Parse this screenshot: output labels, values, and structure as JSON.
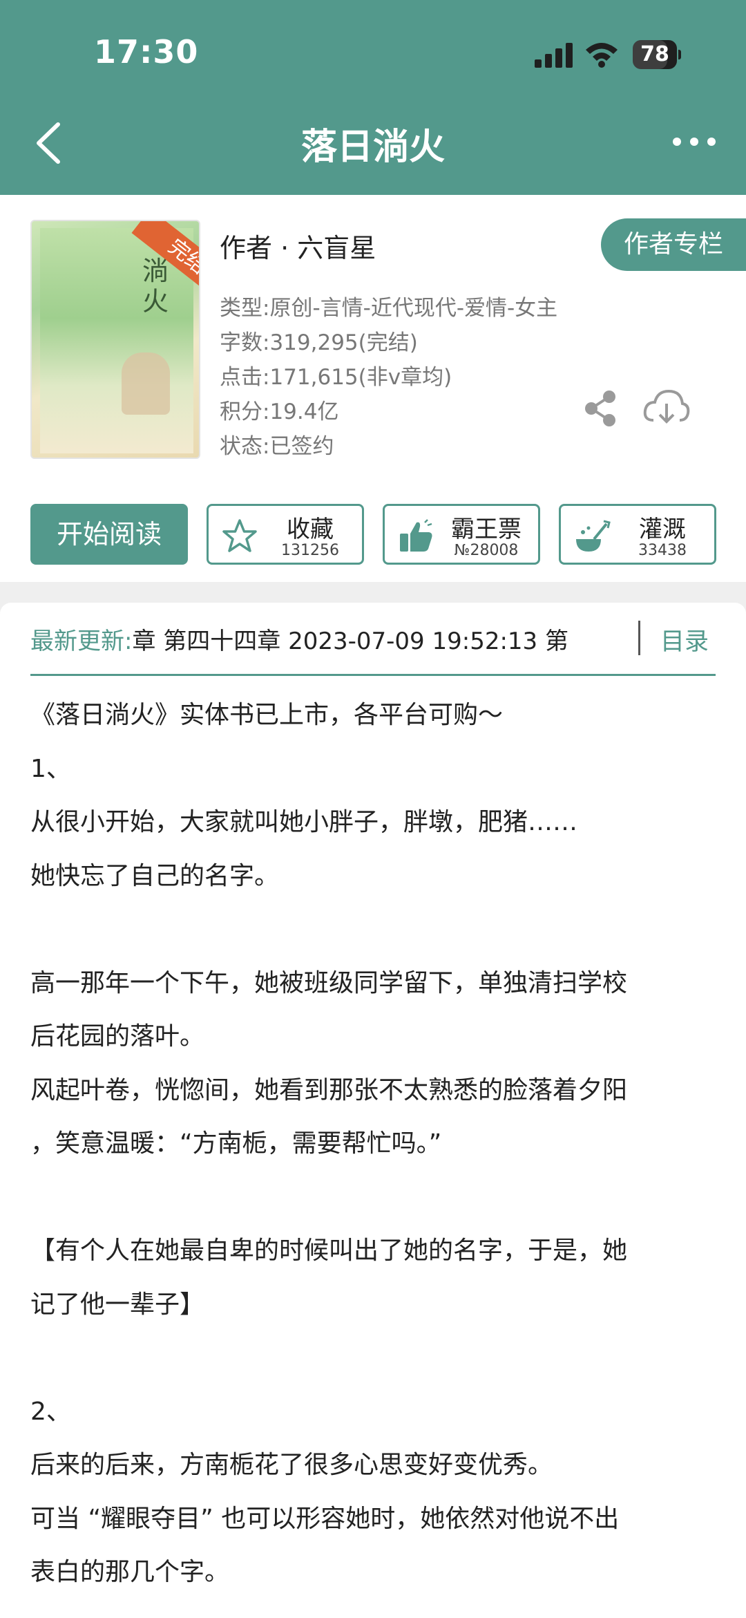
{
  "status_bar": {
    "time": "17:30",
    "battery": "78",
    "battery_level": 0.78
  },
  "nav": {
    "title": "落日淌火"
  },
  "book": {
    "cover_title": "淌火",
    "badge": "完结",
    "author": "作者 · 六盲星",
    "author_column_label": "作者专栏",
    "meta": [
      "类型:原创-言情-近代现代-爱情-女主",
      "字数:319,295(完结)",
      "点击:171,615(非v章均)",
      "积分:19.4亿",
      "状态:已签约"
    ]
  },
  "actions": {
    "read_label": "开始阅读",
    "buttons": [
      {
        "icon": "star-icon",
        "label": "收藏",
        "count": "131256"
      },
      {
        "icon": "thumbs-up-icon",
        "label": "霸王票",
        "count": "№28008"
      },
      {
        "icon": "watering-icon",
        "label": "灌溉",
        "count": "33438"
      }
    ]
  },
  "latest_update": {
    "label": "最新更新:",
    "text": "章 第四十四章 2023-07-09 19:52:13  第",
    "toc_label": "目录"
  },
  "intro": [
    "《落日淌火》实体书已上市，各平台可购～",
    "1、",
    "从很小开始，大家就叫她小胖子，胖墩，肥猪……",
    "她快忘了自己的名字。",
    "",
    "高一那年一个下午，她被班级同学留下，单独清扫学校",
    "后花园的落叶。",
    "风起叶卷，恍惚间，她看到那张不太熟悉的脸落着夕阳",
    "，笑意温暖：“方南栀，需要帮忙吗。”",
    "",
    "【有个人在她最自卑的时候叫出了她的名字，于是，她",
    "记了他一辈子】",
    "",
    "2、",
    "后来的后来，方南栀花了很多心思变好变优秀。",
    "可当 “耀眼夺目” 也可以形容她时，她依然对他说不出",
    "表白的那几个字。"
  ],
  "colors": {
    "accent": "#53998c",
    "badge": "#e06433"
  }
}
